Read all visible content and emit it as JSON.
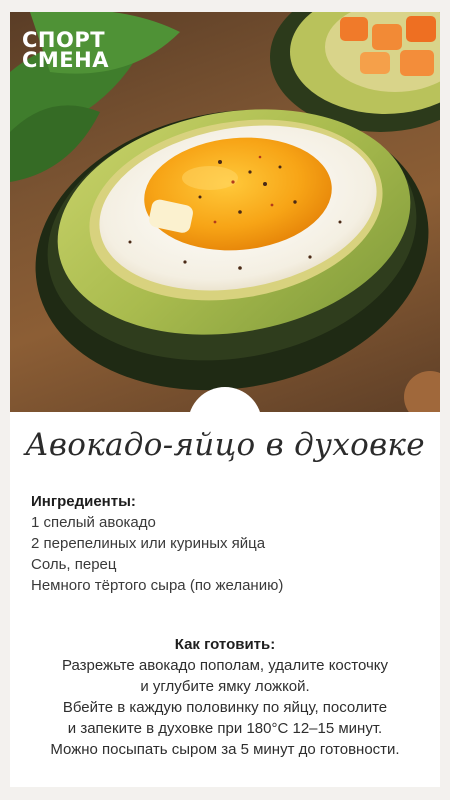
{
  "brand": {
    "line1": "СПОРТ",
    "line2": "СМЕНА"
  },
  "title": "Авокадо-яйцо в духовке",
  "ingredients": {
    "heading": "Ингредиенты:",
    "items": [
      "1 спелый авокадо",
      "2 перепелиных или куриных яйца",
      "Соль, перец",
      "Немного тёртого сыра (по желанию)"
    ]
  },
  "howto": {
    "heading": "Как готовить:",
    "lines": [
      "Разрежьте авокадо пополам, удалите косточку",
      "и углубите ямку ложкой.",
      "Вбейте в каждую половинку по яйцу, посолите",
      "и запеките в духовке при 180°C 12–15 минут.",
      "Можно посыпать сыром за 5 минут до готовности."
    ]
  },
  "colors": {
    "avocado_skin": "#2f3a1e",
    "avocado_flesh": "#9bb24a",
    "egg_white": "#f7f3ea",
    "yolk": "#f59a10",
    "board": "#7b5432"
  }
}
